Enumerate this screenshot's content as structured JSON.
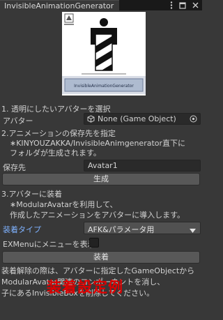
{
  "window": {
    "tab_title": "InvisibleAnimationGenerator",
    "menu_icon": "kebab-menu-icon",
    "maximize_icon": "maximize-icon",
    "close_icon": "close-icon"
  },
  "logo": {
    "name": "KINYOUZAKKA logo",
    "banner_text": "InvisibleAnimationGenerator"
  },
  "section1": {
    "heading": "1. 透明にしたいアバターを選択",
    "avatar_label": "アバター",
    "avatar_value": "None (Game Object)",
    "object_icon": "cube-icon",
    "picker_icon": "object-picker-icon"
  },
  "section2": {
    "heading": "2.アニメーションの保存先を指定",
    "note_line1": "∗KINYOUZAKKA/InvisibleAnimgenerator直下に",
    "note_line2": "フォルダが生成されます。",
    "save_label": "保存先",
    "save_value": "Avatar1",
    "generate_button": "生成"
  },
  "section3": {
    "heading": "3.アバターに装着",
    "note_line1": "∗ModularAvatarを利用して、",
    "note_line2": "作成したアニメーションをアバターに導入します。",
    "type_label": "装着タイプ",
    "type_value": "AFK&パラメータ用",
    "exmenu_label": "EXMenuにメニューを表示",
    "exmenu_checked": false,
    "attach_button": "装着"
  },
  "footer": {
    "line1": "装着解除の際は、アバターに指定したGameObjectから",
    "line2": "ModularAvatar関連のコンポーネントを消し、",
    "line3": "子にあるInvisibleBoxを削除してください。"
  },
  "overlay_caption": "装着設定例",
  "colors": {
    "background": "#383838",
    "accent_label": "#7fb2ff",
    "caption": "#e00000"
  }
}
